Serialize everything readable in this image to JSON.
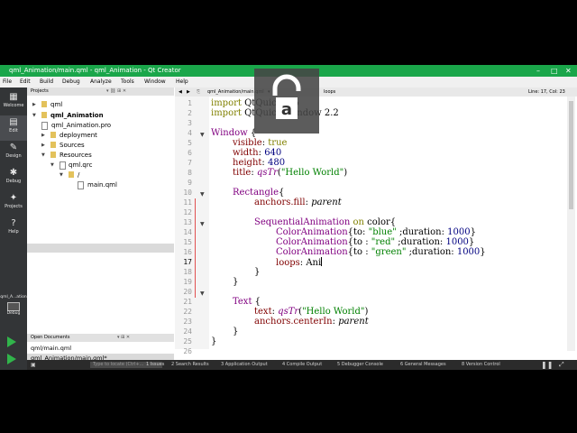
{
  "window": {
    "title": "qml_Animation/main.qml - qml_Animation - Qt Creator"
  },
  "menu": [
    "File",
    "Edit",
    "Build",
    "Debug",
    "Analyze",
    "Tools",
    "Window",
    "Help"
  ],
  "modes": [
    {
      "label": "Welcome",
      "icon": "▦"
    },
    {
      "label": "Edit",
      "icon": "▤"
    },
    {
      "label": "Design",
      "icon": "✎"
    },
    {
      "label": "Debug",
      "icon": "✱"
    },
    {
      "label": "Projects",
      "icon": "✦"
    },
    {
      "label": "Help",
      "icon": "?"
    }
  ],
  "kit": {
    "label": "qml_A...ation",
    "mode": "Debug"
  },
  "projects_panel": {
    "header": "Projects"
  },
  "tree": [
    {
      "label": "qml"
    },
    {
      "label": "qml_Animation"
    },
    {
      "label": "qml_Animation.pro"
    },
    {
      "label": "deployment"
    },
    {
      "label": "Sources"
    },
    {
      "label": "Resources"
    },
    {
      "label": "qml.qrc"
    },
    {
      "label": "/"
    },
    {
      "label": "main.qml"
    }
  ],
  "open_documents": {
    "header": "Open Documents",
    "items": [
      "qml/main.qml",
      "qml_Animation/main.qml*"
    ]
  },
  "editor_toolbar": {
    "file": "qml_Animation/main.qml",
    "symbol": "loops",
    "position": "Line: 17, Col: 23"
  },
  "line_numbers": [
    "1",
    "2",
    "3",
    "4",
    "5",
    "6",
    "7",
    "8",
    "9",
    "10",
    "11",
    "12",
    "13",
    "14",
    "15",
    "16",
    "17",
    "18",
    "19",
    "20",
    "21",
    "22",
    "23",
    "24",
    "25",
    "26"
  ],
  "code_tokens": {
    "l1a": "import",
    "l1b": " QtQuick 2.5",
    "l2a": "import",
    "l2b": " QtQuick.Window 2.2",
    "l4a": "Window",
    "l4b": " {",
    "l5a": "visible",
    "l5b": ": ",
    "l5c": "true",
    "l6a": "width",
    "l6b": ": ",
    "l6c": "640",
    "l7a": "height",
    "l7b": ": ",
    "l7c": "480",
    "l8a": "title",
    "l8b": ": ",
    "l8c": "qsTr",
    "l8d": "(",
    "l8e": "\"Hello World\"",
    "l8f": ")",
    "l10a": "Rectangle",
    "l10b": "{",
    "l11a": "anchors.fill",
    "l11b": ": ",
    "l11c": "parent",
    "l13a": "SequentialAnimation",
    "l13b": " ",
    "l13c": "on",
    "l13d": " color{",
    "l14a": "ColorAnimation",
    "l14b": "{to: ",
    "l14c": "\"blue\"",
    "l14d": " ;duration: ",
    "l14e": "1000",
    "l14f": "}",
    "l15a": "ColorAnimation",
    "l15b": "{to : ",
    "l15c": "\"red\"",
    "l15d": " ;duration: ",
    "l15e": "1000",
    "l15f": "}",
    "l16a": "ColorAnimation",
    "l16b": "{to : ",
    "l16c": "\"green\"",
    "l16d": " ;duration: ",
    "l16e": "1000",
    "l16f": "}",
    "l17a": "loops",
    "l17b": ": Ani",
    "l18": "}",
    "l19": "}",
    "l21a": "Text",
    "l21b": " {",
    "l22a": "text",
    "l22b": ": ",
    "l22c": "qsTr",
    "l22d": "(",
    "l22e": "\"Hello World\"",
    "l22f": ")",
    "l23a": "anchors.centerIn",
    "l23b": ": ",
    "l23c": "parent",
    "l24": "}",
    "l25": "}"
  },
  "statusbar": {
    "locator_placeholder": "Type to locate (Ctrl+...",
    "panes": [
      "1  Issues",
      "2  Search Results",
      "3  Application Output",
      "4  Compile Output",
      "5  Debugger Console",
      "6  General Messages",
      "8  Version Control"
    ]
  },
  "overlay": {
    "letter": "a"
  },
  "colors": {
    "title_bar": "#1aa64a",
    "mode_bar": "#333537",
    "keyword": "#808000",
    "type": "#800080",
    "property": "#800000",
    "number": "#000080",
    "string": "#008000"
  }
}
